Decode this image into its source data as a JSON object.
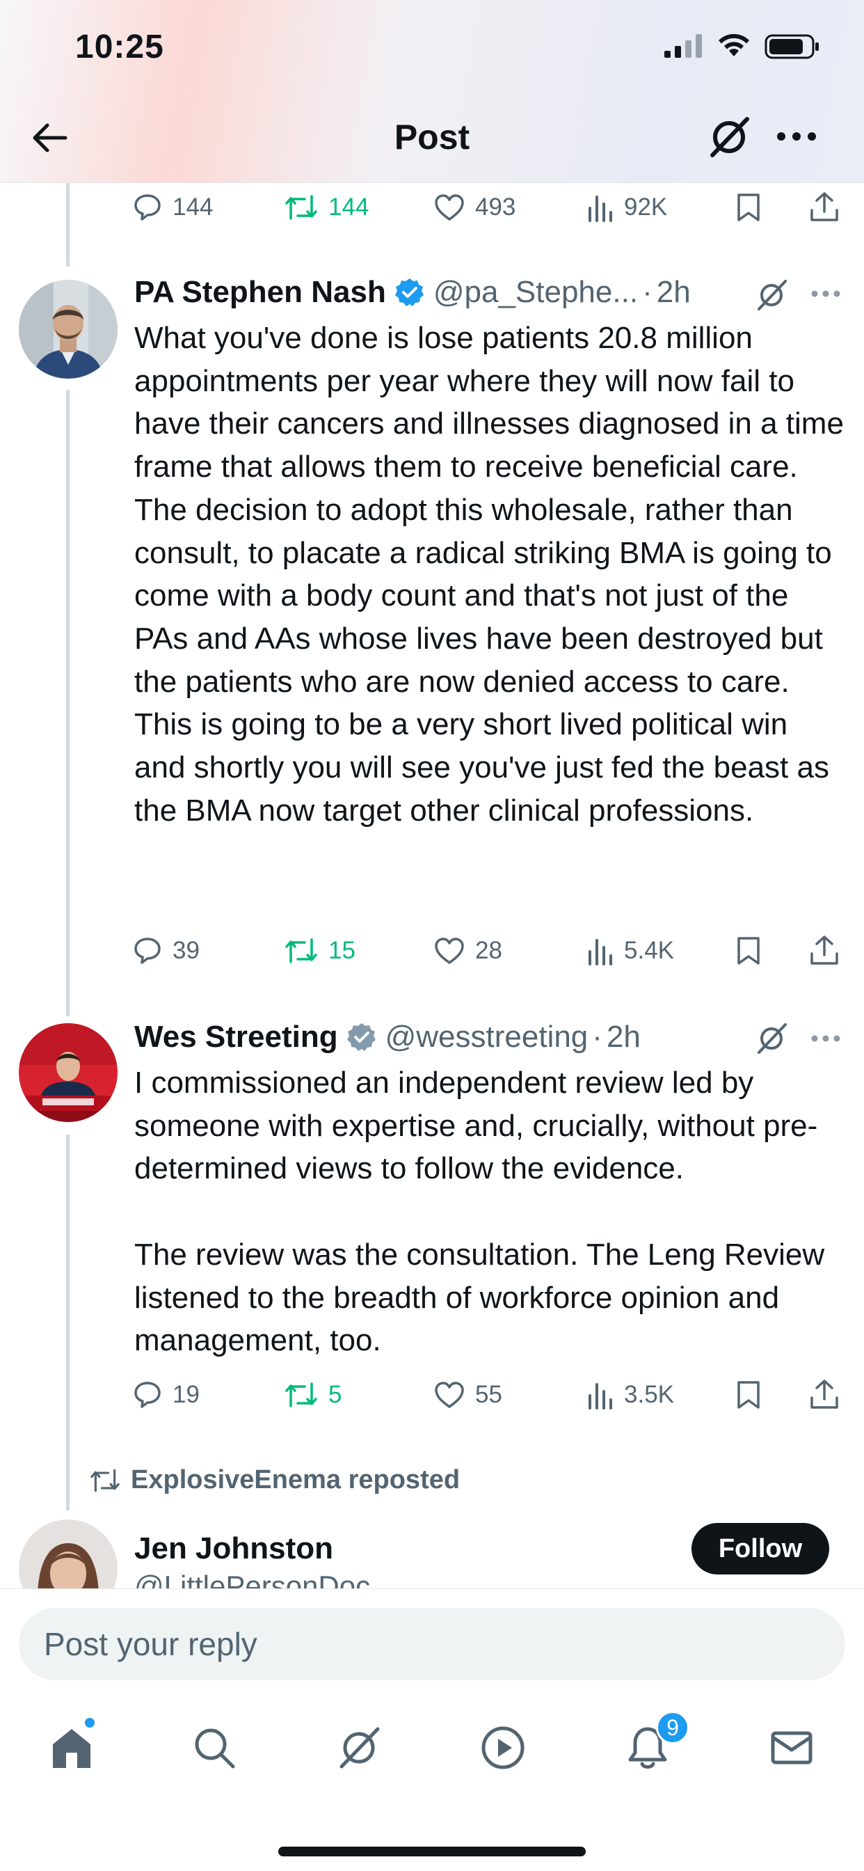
{
  "status_bar": {
    "time": "10:25"
  },
  "header": {
    "title": "Post"
  },
  "top_actions": {
    "replies": "144",
    "reposts": "144",
    "likes": "493",
    "views": "92K"
  },
  "tweets": [
    {
      "name": "PA Stephen Nash",
      "handle": "@pa_Stephe...",
      "separator": "·",
      "time": "2h",
      "verified": true,
      "text": "What you've done is lose patients 20.8 million appointments per year where they will now fail to have their cancers and illnesses diagnosed in a time frame that allows them to receive beneficial care. The decision to adopt this wholesale, rather than consult, to placate a radical striking BMA is going to come with a body count and that's not just of the PAs and AAs whose lives have been destroyed but the patients who are now denied access to care. This is going to be a very short lived political win and shortly you will see you've just fed the beast as the BMA now target other clinical professions.",
      "replies": "39",
      "reposts": "15",
      "likes": "28",
      "views": "5.4K"
    },
    {
      "name": "Wes Streeting",
      "handle": "@wesstreeting",
      "separator": "·",
      "time": "2h",
      "verified": true,
      "text": "I commissioned an independent review led by someone with expertise and, crucially, without pre-determined views to follow the evidence.\n\nThe review was the consultation. The Leng Review listened to the breadth of workforce opinion and management, too.",
      "replies": "19",
      "reposts": "5",
      "likes": "55",
      "views": "3.5K"
    }
  ],
  "repost_notice": "ExplosiveEnema reposted",
  "next_post": {
    "name": "Jen Johnston",
    "handle": "@LittlePersonDoc",
    "follow_label": "Follow"
  },
  "reply": {
    "placeholder": "Post your reply"
  },
  "tab_bar": {
    "notifications_badge": "9"
  },
  "colors": {
    "text": "#0f1419",
    "muted": "#536471",
    "accent": "#1d9bf0",
    "repost": "#00ba7c"
  }
}
